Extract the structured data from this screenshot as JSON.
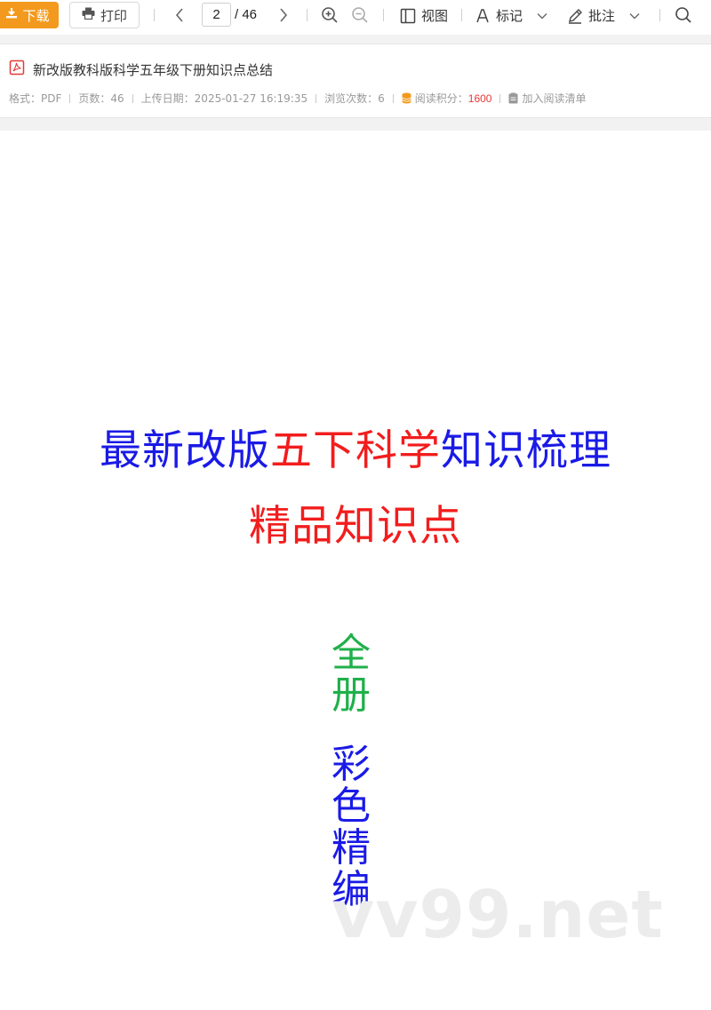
{
  "toolbar": {
    "download_label": "下载",
    "print_label": "打印",
    "current_page": "2",
    "total_pages": "/ 46",
    "view_label": "视图",
    "mark_label": "标记",
    "annotate_label": "批注"
  },
  "doc": {
    "title": "新改版教科版科学五年级下册知识点总结",
    "format": "格式：PDF",
    "pages": "页数：46",
    "upload_date": "上传日期：2025-01-27 16:19:35",
    "views": "浏览次数：6",
    "points_label": "阅读积分：",
    "points_value": "1600",
    "add_to_list": "加入阅读清单"
  },
  "page_content": {
    "headline_blue_1": "最新改版",
    "headline_red": "五下科学",
    "headline_blue_2": "知识梳理",
    "subline": "精品知识点",
    "vertical_green": [
      "全",
      "册"
    ],
    "vertical_blue": [
      "彩",
      "色",
      "精",
      "编"
    ],
    "watermark": "vv99.net"
  },
  "colors": {
    "accent_orange": "#f39a1e",
    "blue_text": "#1a1ae6",
    "red_text": "#f21d1d",
    "green_text": "#1fb04a",
    "points_red": "#e53935"
  }
}
